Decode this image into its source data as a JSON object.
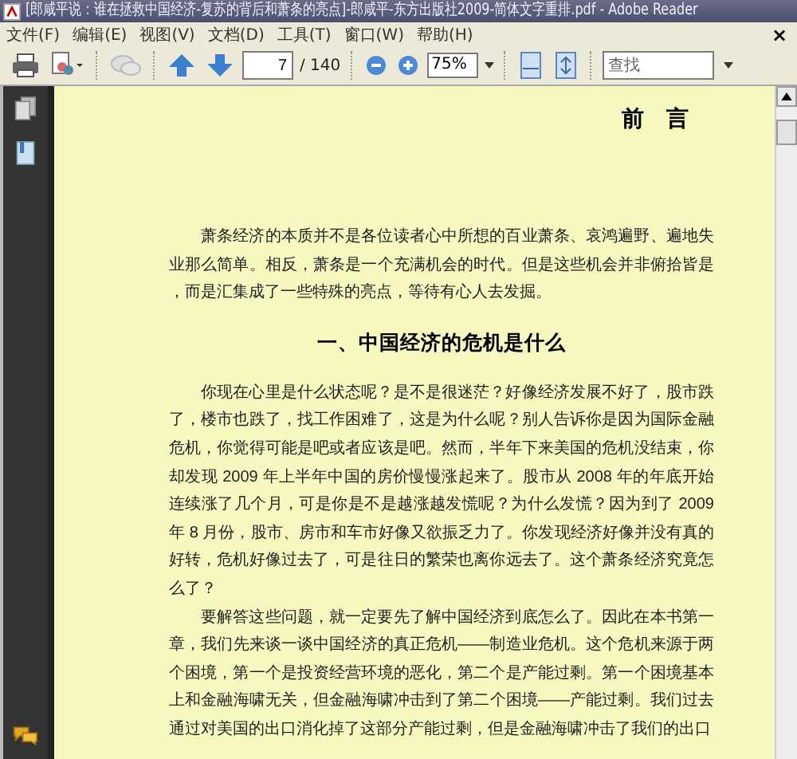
{
  "window": {
    "title": "[郎咸平说：谁在拯救中国经济-复苏的背后和萧条的亮点]-郎咸平-东方出版社2009-简体文字重排.pdf - Adobe Reader"
  },
  "menu": {
    "items": [
      "文件(F)",
      "编辑(E)",
      "视图(V)",
      "文档(D)",
      "工具(T)",
      "窗口(W)",
      "帮助(H)"
    ],
    "close": "×"
  },
  "toolbar": {
    "page_field": "7",
    "page_total": "/ 140",
    "zoom_field": "75%",
    "search": {
      "placeholder": "查找"
    }
  },
  "document": {
    "blocks": [
      {
        "kind": "title",
        "text": "前　言"
      },
      {
        "kind": "paragraph",
        "text": "萧条经济的本质并不是各位读者心中所想的百业萧条、哀鸿遍野、遍地失业那么简单。相反，萧条是一个充满机会的时代。但是这些机会并非俯拾皆是，而是汇集成了一些特殊的亮点，等待有心人去发掘。"
      },
      {
        "kind": "heading",
        "text": "一、中国经济的危机是什么"
      },
      {
        "kind": "paragraph",
        "text": "你现在心里是什么状态呢？是不是很迷茫？好像经济发展不好了，股市跌了，楼市也跌了，找工作困难了，这是为什么呢？别人告诉你是因为国际金融危机，你觉得可能是吧或者应该是吧。然而，半年下来美国的危机没结束，你却发现 2009 年上半年中国的房价慢慢涨起来了。股市从 2008 年的年底开始连续涨了几个月，可是你是不是越涨越发慌呢？为什么发慌？因为到了 2009 年 8 月份，股市、房市和车市好像又欲振乏力了。你发现经济好像并没有真的好转，危机好像过去了，可是往日的繁荣也离你远去了。这个萧条经济究竟怎么了？"
      },
      {
        "kind": "paragraph",
        "text": "要解答这些问题，就一定要先了解中国经济到底怎么了。因此在本书第一章，我们先来谈一谈中国经济的真正危机——制造业危机。这个危机来源于两个困境，第一个是投资经营环境的恶化，第二个是产能过剩。第一个困境基本上和金融海啸无关，但金融海啸冲击到了第二个困境——产能过剩。我们过去通过对美国的出口消化掉了这部分产能过剩，但是金融海啸冲击了我们的出口"
      }
    ]
  }
}
